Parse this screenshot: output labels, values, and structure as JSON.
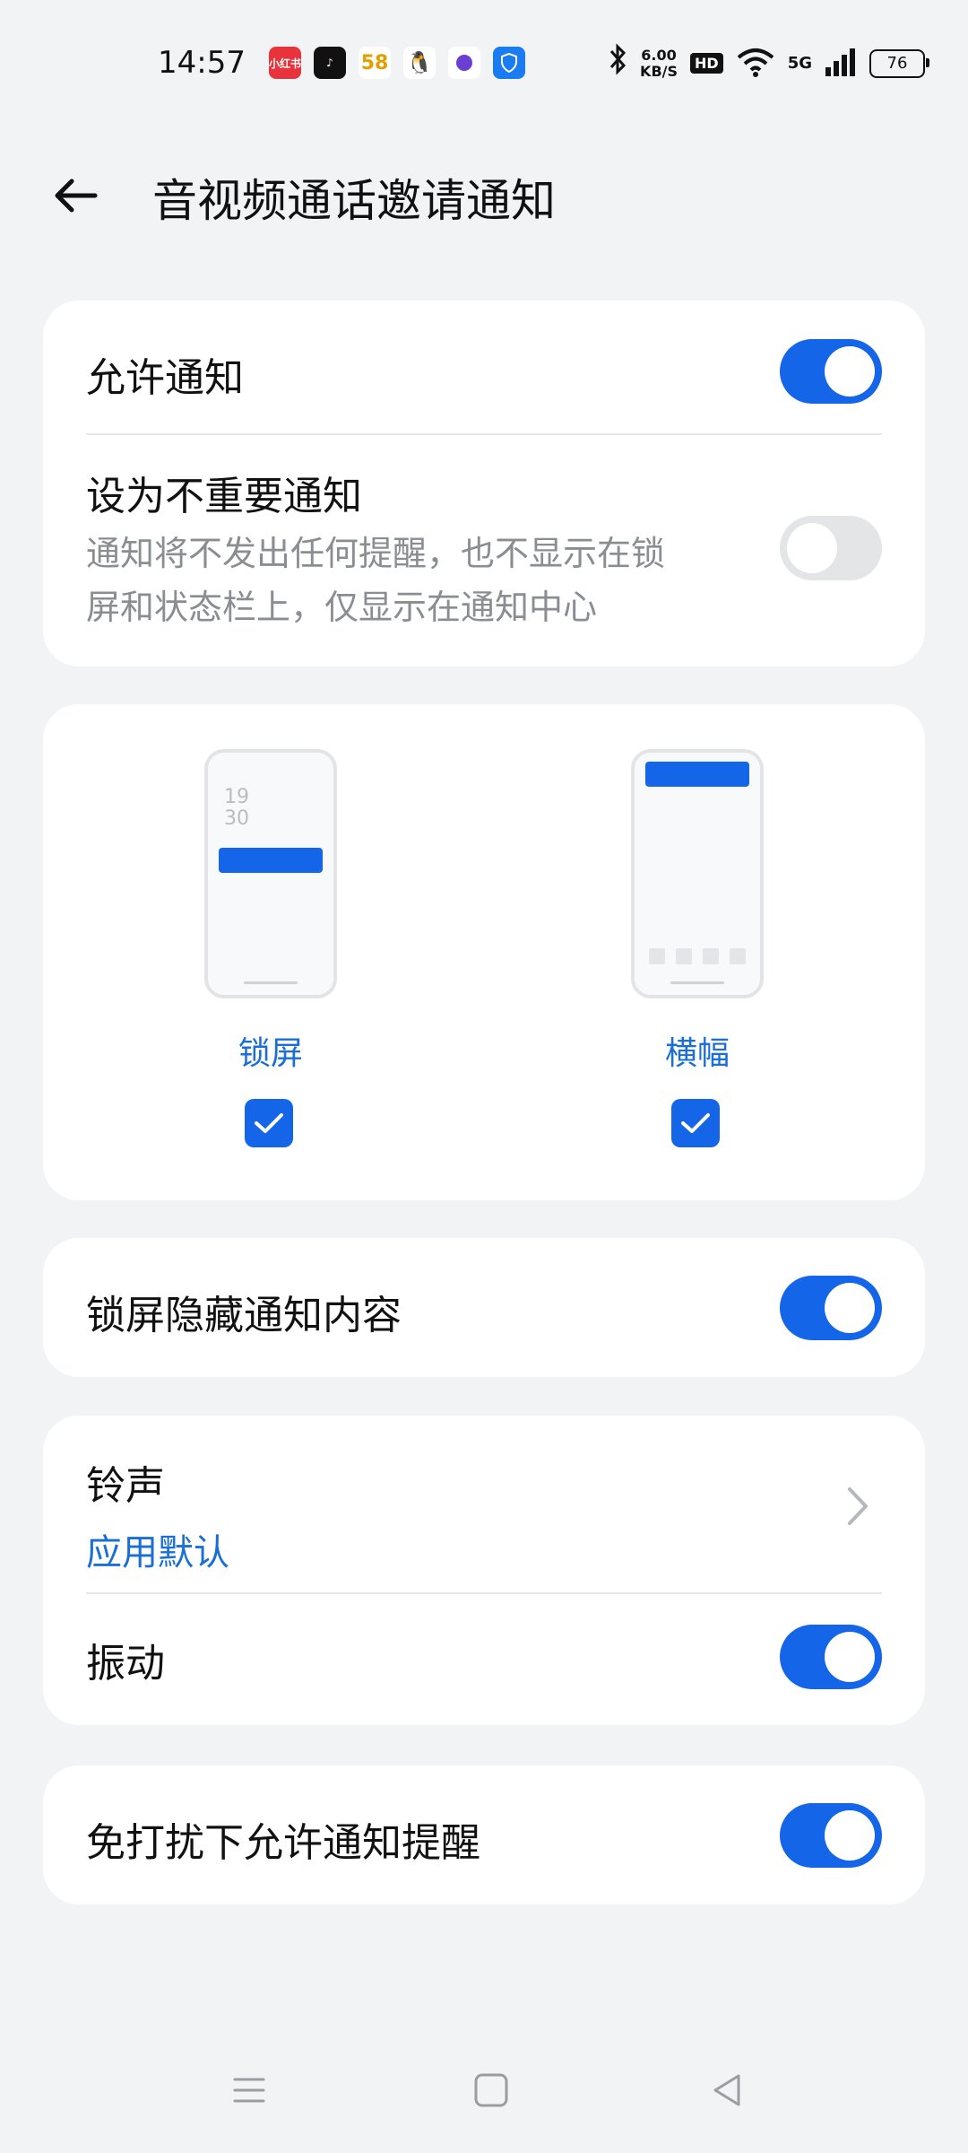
{
  "status_bar": {
    "time": "14:57",
    "apps": [
      "小红书",
      "抖音",
      "58",
      "QQ",
      "浏览器",
      "安全"
    ],
    "speed_value": "6.00",
    "speed_unit": "KB/S",
    "hd": "HD",
    "network": "5G",
    "battery": "76"
  },
  "header": {
    "title": "音视频通话邀请通知"
  },
  "allow_card": {
    "allow_label": "允许通知",
    "allow_on": true,
    "unimportant_label": "设为不重要通知",
    "unimportant_desc_1": "通知将不发出任何提醒，也不显示在锁",
    "unimportant_desc_2": "屏和状态栏上，仅显示在通知中心",
    "unimportant_on": false
  },
  "style_card": {
    "lockscreen_label": "锁屏",
    "lockscreen_clock_1": "19",
    "lockscreen_clock_2": "30",
    "lockscreen_checked": true,
    "banner_label": "横幅",
    "banner_checked": true
  },
  "hide_card": {
    "label": "锁屏隐藏通知内容",
    "on": true
  },
  "sound_card": {
    "ringtone_label": "铃声",
    "ringtone_value": "应用默认",
    "vibrate_label": "振动",
    "vibrate_on": true
  },
  "dnd_card": {
    "label": "免打扰下允许通知提醒",
    "on": true
  },
  "colors": {
    "accent": "#1565e9",
    "link": "#1a6fd6",
    "background": "#f2f3f5"
  }
}
